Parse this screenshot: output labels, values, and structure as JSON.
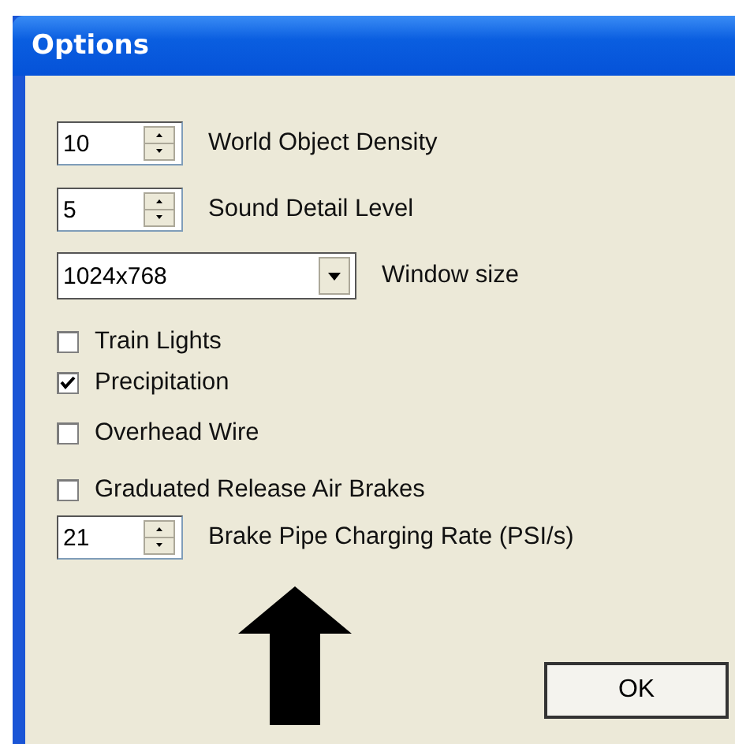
{
  "window": {
    "title": "Options"
  },
  "settings": [
    {
      "kind": "spinner",
      "value": "10",
      "label": "World Object Density"
    },
    {
      "kind": "spinner",
      "value": "5",
      "label": "Sound Detail Level"
    },
    {
      "kind": "combo",
      "value": "1024x768",
      "label": "Window size"
    }
  ],
  "checkboxes": [
    {
      "label": "Train Lights",
      "checked": false
    },
    {
      "label": "Precipitation",
      "checked": true
    },
    {
      "label": "Overhead Wire",
      "checked": false
    },
    {
      "label": "Graduated Release Air Brakes",
      "checked": false
    }
  ],
  "brake_setting": {
    "value": "21",
    "label": "Brake Pipe Charging Rate (PSI/s)"
  },
  "buttons": [
    "OK"
  ]
}
